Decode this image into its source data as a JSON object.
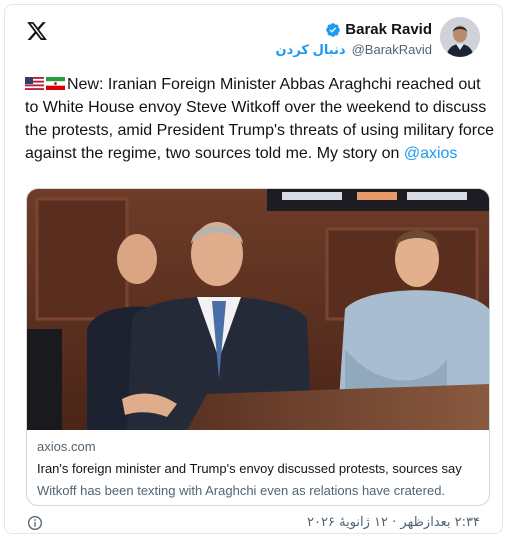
{
  "author": {
    "display_name": "Barak Ravid",
    "handle": "@BarakRavid",
    "follow_label": "دنبال کردن",
    "verified_icon": "verified-badge-icon",
    "avatar_icon": "profile-avatar"
  },
  "logo_icon": "x-logo-icon",
  "tweet": {
    "flags": [
      "us-flag-icon",
      "iran-flag-icon"
    ],
    "text": "New: Iranian Foreign Minister Abbas Araghchi reached out to White House envoy Steve Witkoff over the weekend to discuss the protests, amid President Trump's threats of using military force against the regime, two sources told me. My story on ",
    "mention": "@axios"
  },
  "link_card": {
    "domain": "axios.com",
    "title": "Iran's foreign minister and Trump's envoy discussed protests, sources say",
    "description": "Witkoff has been texting with Araghchi even as relations have cratered."
  },
  "footer": {
    "info_icon": "info-icon",
    "timestamp": "۲:۳۴ بعدازظهر · ۱۲ ژانویهٔ ۲۰۲۶"
  },
  "colors": {
    "link": "#1d9bf0",
    "secondary_text": "#536471",
    "primary_text": "#0f1419",
    "border": "#cfd9de"
  }
}
